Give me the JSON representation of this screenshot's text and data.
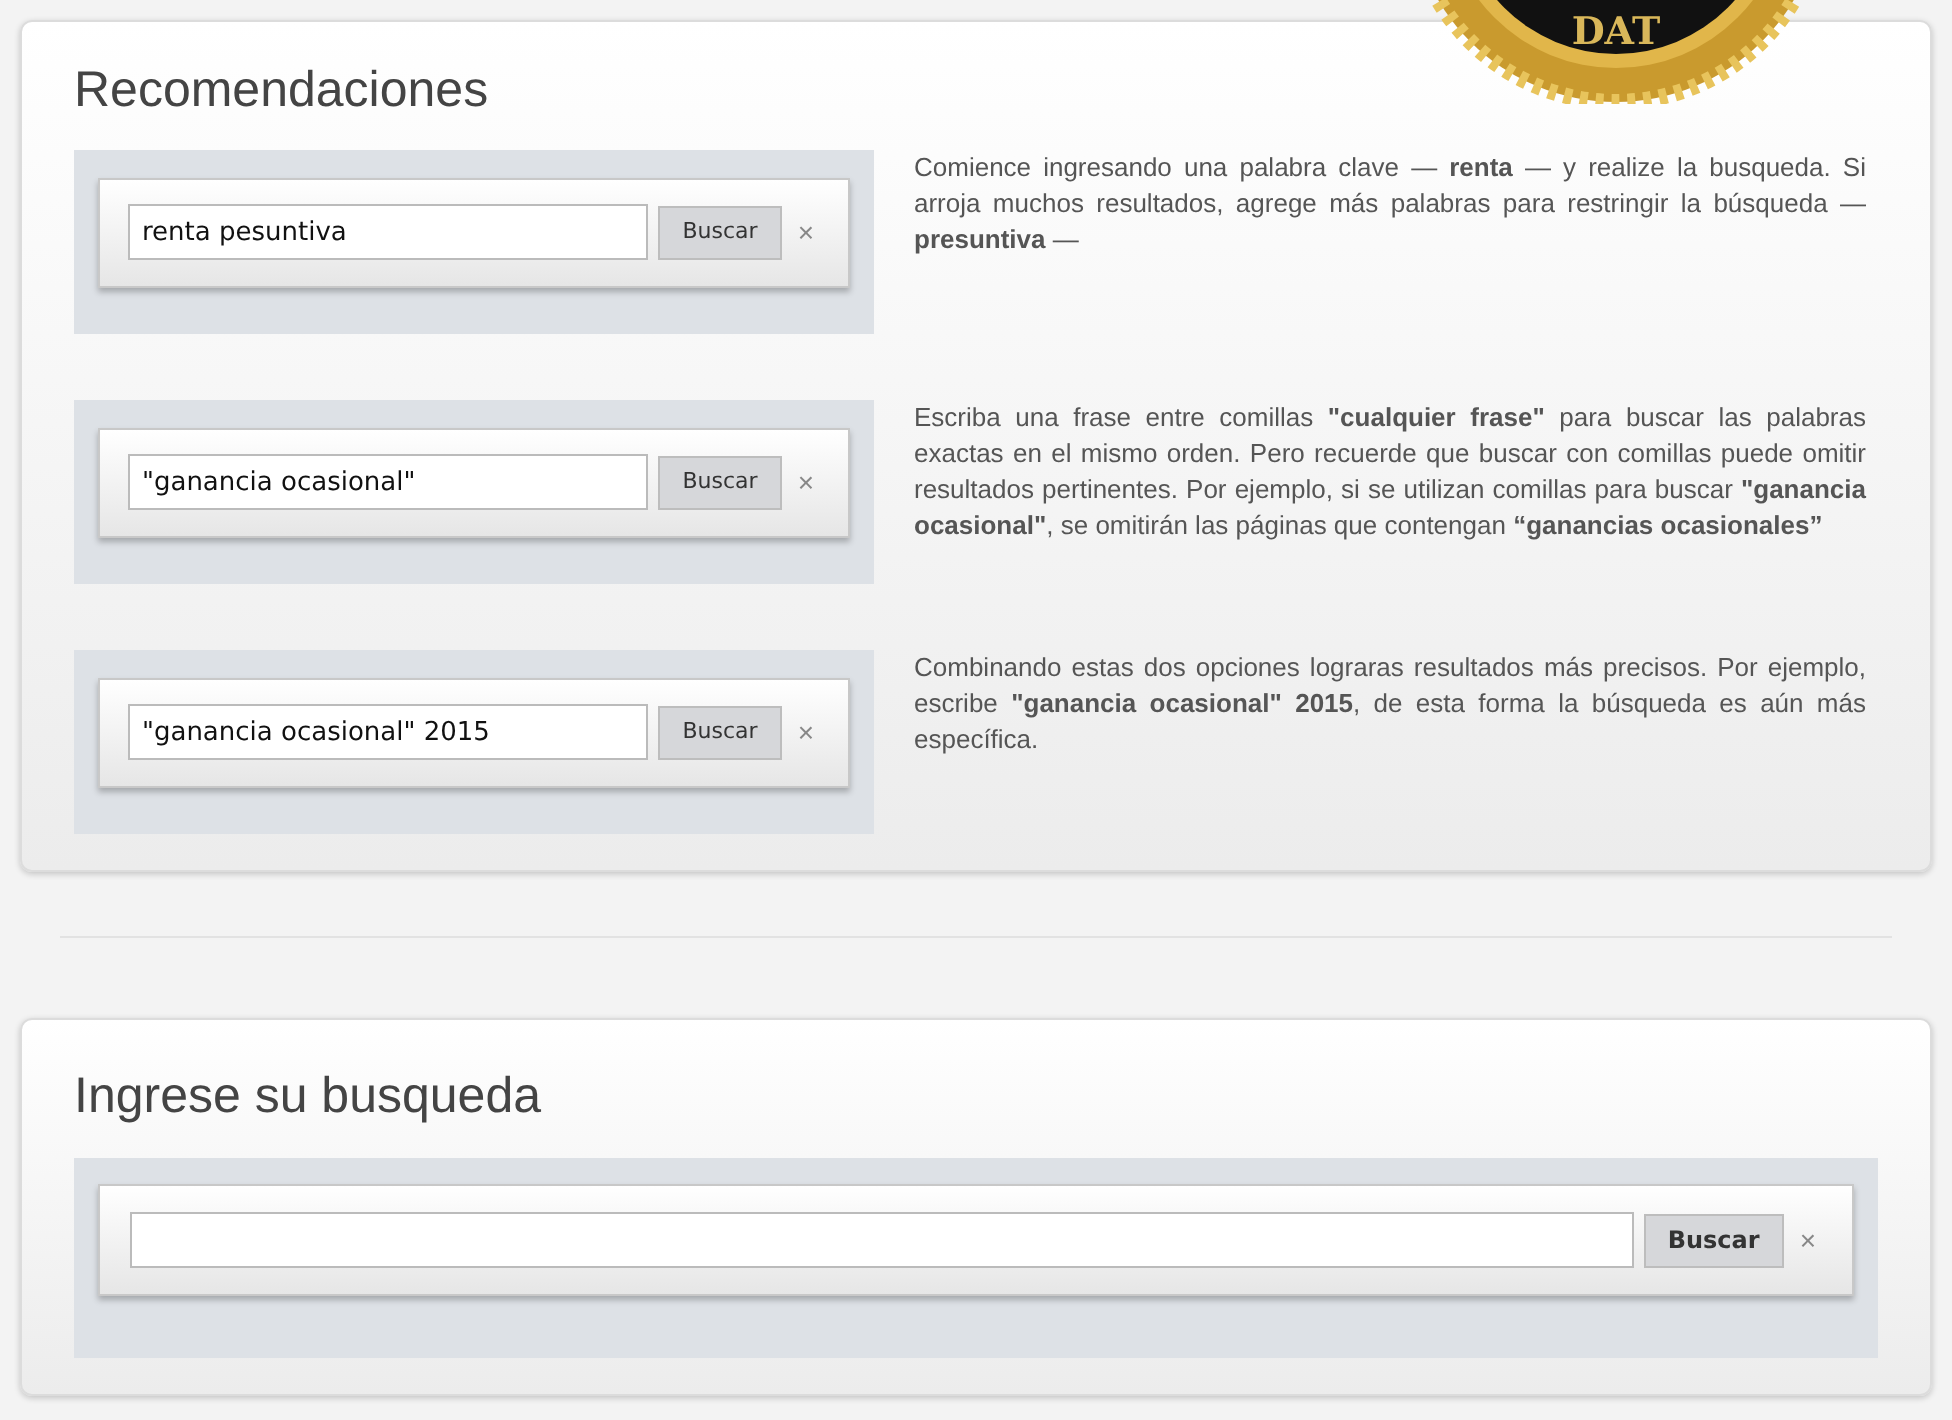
{
  "seal": {
    "text": "DAT"
  },
  "recommendations": {
    "title": "Recomendaciones",
    "examples": [
      {
        "value": "renta pesuntiva",
        "button": "Buscar",
        "clear": "×",
        "description": "Comience ingresando una palabra clave — **renta** — y realize la busqueda. Si arroja muchos resultados, agrege más palabras para restringir la búsqueda — **presuntiva** —"
      },
      {
        "value": "\"ganancia ocasional\"",
        "button": "Buscar",
        "clear": "×",
        "description": "Escriba una frase entre comillas **\"cualquier frase\"** para buscar las palabras exactas en el mismo orden. Pero recuerde que buscar con comillas puede omitir resultados pertinentes. Por ejemplo, si se utilizan comillas para buscar **\"ganancia ocasional\"**, se omitirán las páginas que contengan **“ganancias ocasionales”**"
      },
      {
        "value": "\"ganancia ocasional\" 2015",
        "button": "Buscar",
        "clear": "×",
        "description": "Combinando estas dos opciones lograras resultados más precisos. Por ejemplo, escribe **\"ganancia ocasional\" 2015**, de esta forma la búsqueda es aún más específica."
      }
    ]
  },
  "search": {
    "title": "Ingrese su busqueda",
    "button": "Buscar",
    "clear": "×"
  }
}
